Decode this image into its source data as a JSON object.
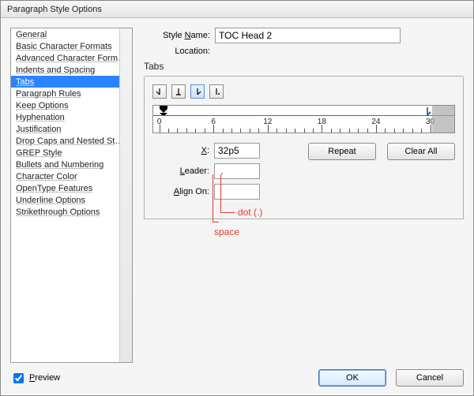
{
  "window": {
    "title": "Paragraph Style Options"
  },
  "fields": {
    "style_name_label": "Style Name:",
    "style_name_value": "TOC Head 2",
    "location_label": "Location:"
  },
  "section": {
    "tabs_title": "Tabs"
  },
  "sidebar": {
    "items": [
      "General",
      "Basic Character Formats",
      "Advanced Character Formats",
      "Indents and Spacing",
      "Tabs",
      "Paragraph Rules",
      "Keep Options",
      "Hyphenation",
      "Justification",
      "Drop Caps and Nested Styles",
      "GREP Style",
      "Bullets and Numbering",
      "Character Color",
      "OpenType Features",
      "Underline Options",
      "Strikethrough Options"
    ],
    "selected_index": 4
  },
  "tab_types": {
    "options": [
      "left-tab",
      "center-tab",
      "right-tab",
      "decimal-tab"
    ],
    "selected_index": 2
  },
  "ruler": {
    "tick_labels": [
      "0",
      "6",
      "12",
      "18",
      "24",
      "30"
    ],
    "tab_stop_position_pct": 91
  },
  "tab_fields": {
    "x_label": "X:",
    "x_value": "32p5",
    "leader_label": "Leader:",
    "leader_value": " .",
    "align_on_label": "Align On:",
    "align_on_value": ""
  },
  "buttons": {
    "repeat": "Repeat",
    "clear_all": "Clear All",
    "ok": "OK",
    "cancel": "Cancel"
  },
  "footer": {
    "preview_label": "Preview",
    "preview_checked": true
  },
  "annotations": {
    "dot": "dot (.)",
    "space": "space"
  }
}
